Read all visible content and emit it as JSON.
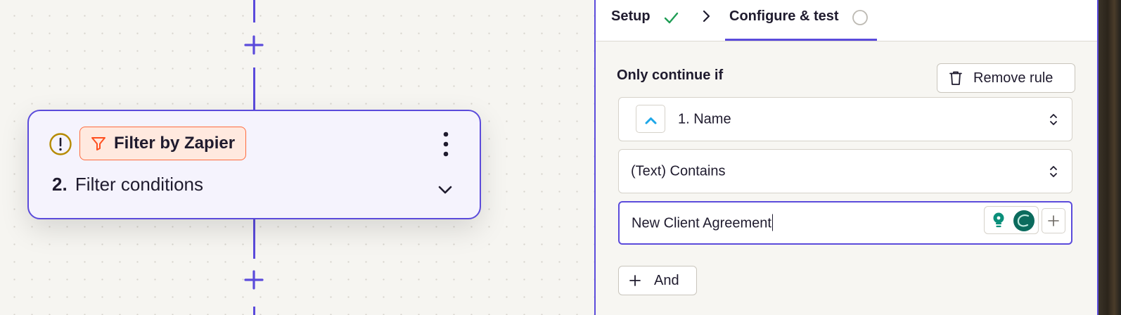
{
  "canvas": {
    "node": {
      "app_name": "Filter by Zapier",
      "step_number": "2.",
      "step_title": "Filter conditions",
      "icons": [
        "warning-icon",
        "filter-icon",
        "more-vertical-icon",
        "chevron-down-icon"
      ]
    },
    "connector_icons": [
      "add-step-icon",
      "add-step-icon"
    ]
  },
  "panel": {
    "tabs": [
      {
        "label": "Setup",
        "status": "complete",
        "icon": "check-icon"
      },
      {
        "label": "Configure & test",
        "status": "incomplete",
        "icon": "circle-icon"
      }
    ],
    "rule": {
      "heading": "Only continue if",
      "remove_label": "Remove rule",
      "field": "1. Name",
      "condition": "(Text) Contains",
      "value": "New Client Agreement"
    },
    "and_label": "And"
  },
  "colors": {
    "accent": "#5b4bdb",
    "badge_border": "#ff6b3d",
    "badge_bg": "#ffe9df",
    "success": "#1f9d55",
    "warning": "#b58a00",
    "ai_teal": "#0a8f7a"
  }
}
